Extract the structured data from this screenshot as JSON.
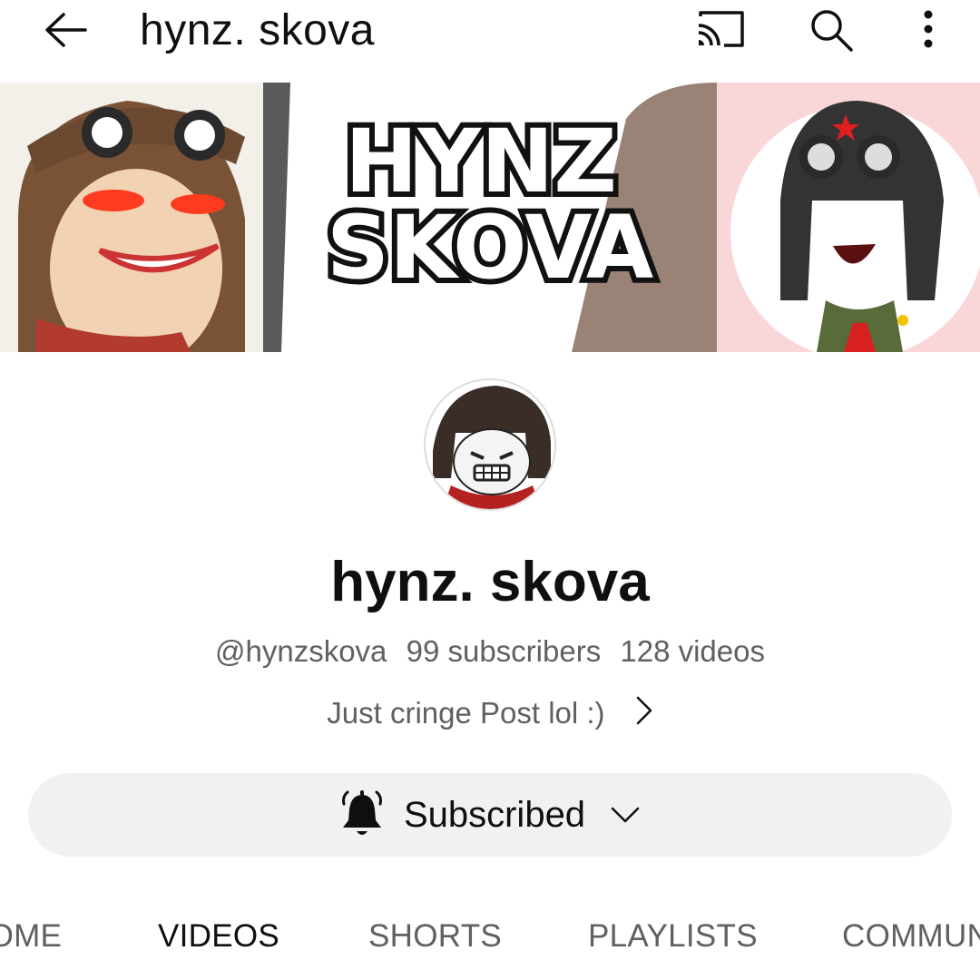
{
  "header": {
    "title": "hynz. skova",
    "back_icon": "arrow-left-icon",
    "cast_icon": "cast-icon",
    "search_icon": "search-icon",
    "more_icon": "more-vertical-icon"
  },
  "banner": {
    "text_line1": "HYNZ",
    "text_line2": "SKOVA"
  },
  "channel": {
    "name": "hynz. skova",
    "handle": "@hynzskova",
    "subscribers": "99 subscribers",
    "videos": "128 videos",
    "description": "Just cringe Post lol :)"
  },
  "subscribe_button": {
    "label": "Subscribed",
    "icon": "bell-ringing-icon"
  },
  "tabs": [
    {
      "label": "HOME",
      "active": false
    },
    {
      "label": "VIDEOS",
      "active": true
    },
    {
      "label": "SHORTS",
      "active": false
    },
    {
      "label": "PLAYLISTS",
      "active": false
    },
    {
      "label": "COMMUNITY",
      "active": false
    }
  ],
  "colors": {
    "text_primary": "#0f0f0f",
    "text_secondary": "#606060",
    "button_bg": "#f1f1f1"
  }
}
